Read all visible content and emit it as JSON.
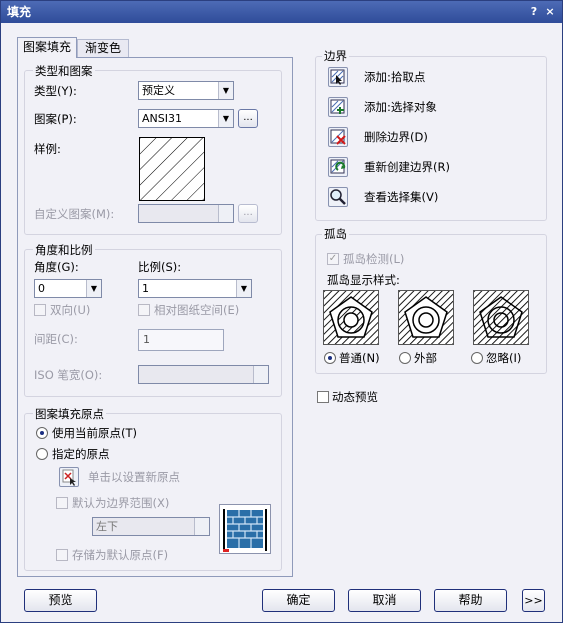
{
  "window": {
    "title": "填充",
    "help": "?",
    "close": "×"
  },
  "tabs": [
    {
      "label": "图案填充"
    },
    {
      "label": "渐变色"
    }
  ],
  "type_pattern": {
    "title": "类型和图案",
    "type_label": "类型(Y):",
    "type_value": "预定义",
    "pattern_label": "图案(P):",
    "pattern_value": "ANSI31",
    "browse": "...",
    "sample_label": "样例:",
    "custom_label": "自定义图案(M):",
    "custom_browse": "..."
  },
  "angle_scale": {
    "title": "角度和比例",
    "angle_label": "角度(G):",
    "angle_value": "0",
    "scale_label": "比例(S):",
    "scale_value": "1",
    "double_label": "双向(U)",
    "relative_label": "相对图纸空间(E)",
    "spacing_label": "间距(C):",
    "spacing_value": "1",
    "iso_label": "ISO 笔宽(O):"
  },
  "origin": {
    "title": "图案填充原点",
    "use_current": "使用当前原点(T)",
    "specified": "指定的原点",
    "click_set": "单击以设置新原点",
    "default_extents": "默认为边界范围(X)",
    "position_value": "左下",
    "store_default": "存储为默认原点(F)"
  },
  "boundaries": {
    "title": "边界",
    "items": [
      {
        "label": "添加:拾取点",
        "icon": "pick-point-icon"
      },
      {
        "label": "添加:选择对象",
        "icon": "select-objects-icon"
      },
      {
        "label": "删除边界(D)",
        "icon": "remove-boundary-icon"
      },
      {
        "label": "重新创建边界(R)",
        "icon": "recreate-boundary-icon"
      },
      {
        "label": "查看选择集(V)",
        "icon": "view-selection-icon"
      }
    ]
  },
  "islands": {
    "title": "孤岛",
    "detect_label": "孤岛检测(L)",
    "style_label": "孤岛显示样式:",
    "options": [
      {
        "label": "普通(N)"
      },
      {
        "label": "外部"
      },
      {
        "label": "忽略(I)"
      }
    ],
    "selected": "普通(N)"
  },
  "dynamic_preview": "动态预览",
  "buttons": {
    "preview": "预览",
    "ok": "确定",
    "cancel": "取消",
    "help": "帮助",
    "more": ">>"
  }
}
